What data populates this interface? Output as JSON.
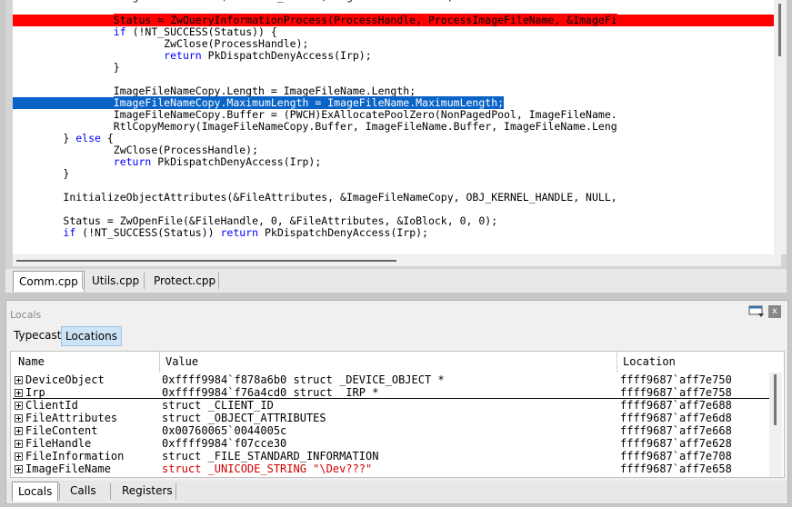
{
  "editor": {
    "lines": [
      {
        "text": "                ImageFileName = *(PUNICODE_STRING)ImageFileNameBuffer;",
        "style": "normal"
      },
      {
        "text": "",
        "style": "normal"
      },
      {
        "text": "                Status = ZwQueryInformationProcess(ProcessHandle, ProcessImageFileName, &ImageFi",
        "style": "red"
      },
      {
        "text": "                if (!NT_SUCCESS(Status)) {",
        "style": "normal"
      },
      {
        "text": "                        ZwClose(ProcessHandle);",
        "style": "normal"
      },
      {
        "text": "                        return PkDispatchDenyAccess(Irp);",
        "style": "normal"
      },
      {
        "text": "                }",
        "style": "normal"
      },
      {
        "text": "",
        "style": "normal"
      },
      {
        "text": "                ImageFileNameCopy.Length = ImageFileName.Length;",
        "style": "normal"
      },
      {
        "text": "                ImageFileNameCopy.MaximumLength = ImageFileName.MaximumLength;",
        "style": "blue"
      },
      {
        "text": "                ImageFileNameCopy.Buffer = (PWCH)ExAllocatePoolZero(NonPagedPool, ImageFileName.",
        "style": "normal"
      },
      {
        "text": "                RtlCopyMemory(ImageFileNameCopy.Buffer, ImageFileName.Buffer, ImageFileName.Leng",
        "style": "normal"
      },
      {
        "text": "        } else {",
        "style": "normal"
      },
      {
        "text": "                ZwClose(ProcessHandle);",
        "style": "normal"
      },
      {
        "text": "                return PkDispatchDenyAccess(Irp);",
        "style": "normal"
      },
      {
        "text": "        }",
        "style": "normal"
      },
      {
        "text": "",
        "style": "normal"
      },
      {
        "text": "        InitializeObjectAttributes(&FileAttributes, &ImageFileNameCopy, OBJ_KERNEL_HANDLE, NULL,",
        "style": "normal"
      },
      {
        "text": "",
        "style": "normal"
      },
      {
        "text": "        Status = ZwOpenFile(&FileHandle, 0, &FileAttributes, &IoBlock, 0, 0);",
        "style": "normal"
      },
      {
        "text": "        if (!NT_SUCCESS(Status)) return PkDispatchDenyAccess(Irp);",
        "style": "normal"
      }
    ],
    "tabs": [
      "Comm.cpp",
      "Utils.cpp",
      "Protect.cpp"
    ],
    "active_tab": 0
  },
  "locals": {
    "title": "Locals",
    "close_label": "x",
    "subtabs": [
      "Typecast",
      "Locations"
    ],
    "columns": [
      "Name",
      "Value",
      "Location"
    ],
    "rows": [
      {
        "name": "DeviceObject",
        "value": "0xffff9984`f878a6b0 struct _DEVICE_OBJECT *",
        "location": "ffff9687`aff7e750",
        "changed": false
      },
      {
        "name": "Irp",
        "value": "0xffff9984`f76a4cd0 struct _IRP *",
        "location": "ffff9687`aff7e758",
        "changed": false
      },
      {
        "name": "ClientId",
        "value": "struct _CLIENT_ID",
        "location": "ffff9687`aff7e688",
        "changed": false
      },
      {
        "name": "FileAttributes",
        "value": "struct _OBJECT_ATTRIBUTES",
        "location": "ffff9687`aff7e6d8",
        "changed": false
      },
      {
        "name": "FileContent",
        "value": "0x00760065`0044005c",
        "location": "ffff9687`aff7e668",
        "changed": false
      },
      {
        "name": "FileHandle",
        "value": "0xffff9984`f07cce30",
        "location": "ffff9687`aff7e628",
        "changed": false
      },
      {
        "name": "FileInformation",
        "value": "struct _FILE_STANDARD_INFORMATION",
        "location": "ffff9687`aff7e708",
        "changed": false
      },
      {
        "name": "ImageFileName",
        "value": "struct _UNICODE_STRING \"\\Dev???\"",
        "location": "ffff9687`aff7e658",
        "changed": true
      }
    ],
    "bottom_tabs": [
      "Locals",
      "Calls",
      "Registers"
    ],
    "active_bottom_tab": 0
  },
  "colors": {
    "breakpoint_line": "#ff0000",
    "current_line": "#0a64c8",
    "changed_value": "#d00000",
    "keyword": "#0000ff"
  }
}
